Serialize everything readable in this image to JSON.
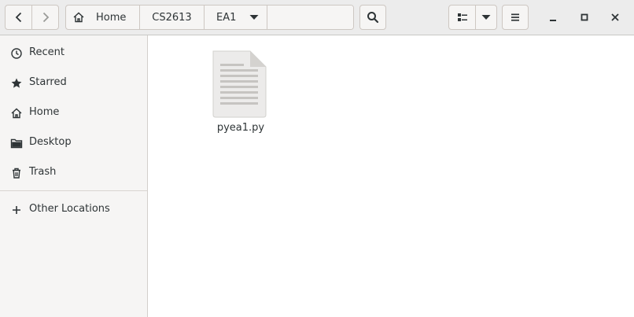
{
  "pathbar": {
    "crumbs": [
      "Home",
      "CS2613",
      "EA1"
    ]
  },
  "sidebar": {
    "items": [
      {
        "label": "Recent",
        "icon": "clock-icon"
      },
      {
        "label": "Starred",
        "icon": "star-icon"
      },
      {
        "label": "Home",
        "icon": "home-icon"
      },
      {
        "label": "Desktop",
        "icon": "folder-icon"
      },
      {
        "label": "Trash",
        "icon": "trash-icon"
      }
    ],
    "other": {
      "label": "Other Locations",
      "icon": "plus-icon"
    }
  },
  "files": [
    {
      "name": "pyea1.py",
      "icon": "text-file-icon"
    }
  ]
}
